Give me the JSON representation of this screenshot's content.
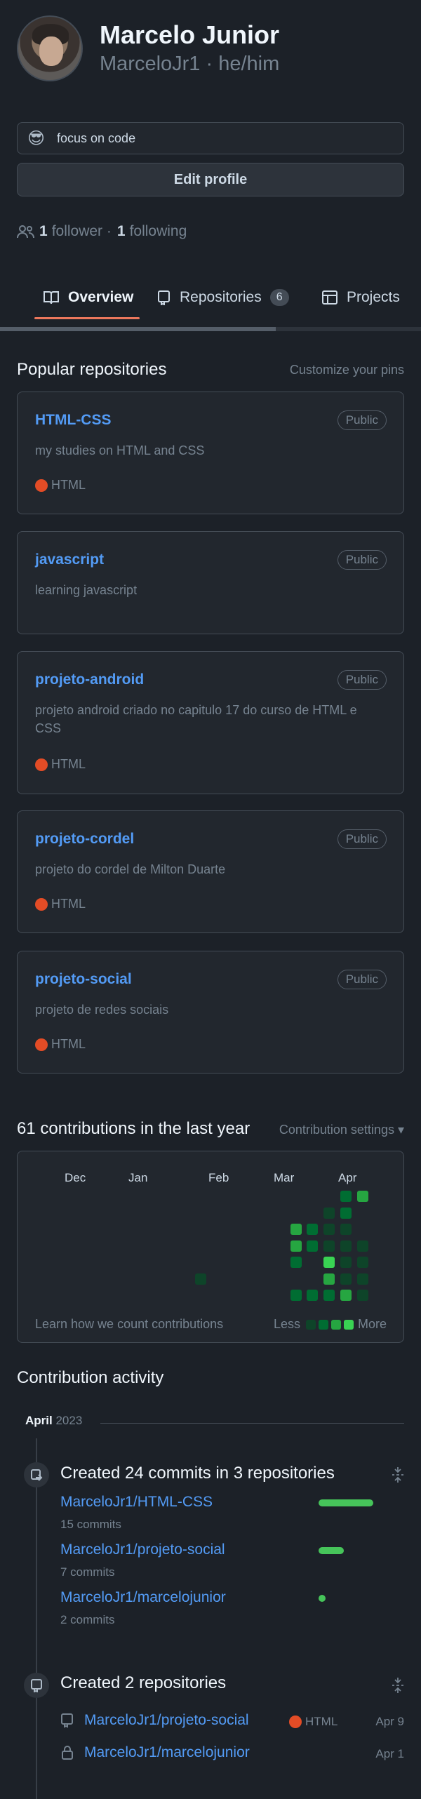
{
  "profile": {
    "fullname": "Marcelo Junior",
    "login": "MarceloJr1 · he/him",
    "status_emoji": "😎",
    "status_text": "focus on code",
    "edit_label": "Edit profile",
    "followers_count": "1",
    "followers_label": "follower ·",
    "following_count": "1",
    "following_label": "following"
  },
  "tabs": [
    {
      "label": "Overview",
      "icon": "book-icon"
    },
    {
      "label": "Repositories",
      "icon": "repo-icon",
      "count": "6"
    },
    {
      "label": "Projects",
      "icon": "table-icon"
    }
  ],
  "popular": {
    "title": "Popular repositories",
    "customize": "Customize your pins",
    "repos": [
      {
        "name": "HTML-CSS",
        "badge": "Public",
        "desc": "my studies on HTML and CSS",
        "lang": "HTML"
      },
      {
        "name": "javascript",
        "badge": "Public",
        "desc": "learning javascript",
        "lang": ""
      },
      {
        "name": "projeto-android",
        "badge": "Public",
        "desc": "projeto android criado no capitulo 17 do curso de HTML e CSS",
        "lang": "HTML"
      },
      {
        "name": "projeto-cordel",
        "badge": "Public",
        "desc": "projeto do cordel de Milton Duarte",
        "lang": "HTML"
      },
      {
        "name": "projeto-social",
        "badge": "Public",
        "desc": "projeto de redes sociais",
        "lang": "HTML"
      }
    ]
  },
  "contributions": {
    "title": "61 contributions in the last year",
    "settings": "Contribution settings ▾",
    "months": [
      "Dec",
      "Jan",
      "Feb",
      "Mar",
      "Apr"
    ],
    "learn": "Learn how we count contributions",
    "less": "Less",
    "more": "More",
    "colors": {
      "l0": "#2d333b",
      "l1": "#0e4429",
      "l2": "#006d32",
      "l3": "#26a641",
      "l4": "#39d353"
    }
  },
  "activity": {
    "title": "Contribution activity",
    "month": "April",
    "year": "2023",
    "commits_head": "Created 24 commits in 3 repositories",
    "commit_repos": [
      {
        "name": "MarceloJr1/HTML-CSS",
        "commits": "15 commits",
        "share": 15
      },
      {
        "name": "MarceloJr1/projeto-social",
        "commits": "7 commits",
        "share": 7
      },
      {
        "name": "MarceloJr1/marcelojunior",
        "commits": "2 commits",
        "share": 2
      }
    ],
    "repos_head": "Created 2 repositories",
    "new_repos": [
      {
        "name": "MarceloJr1/projeto-social",
        "lang": "HTML",
        "date": "Apr 9",
        "icon": "repo-icon"
      },
      {
        "name": "MarceloJr1/marcelojunior",
        "lang": "",
        "date": "Apr 1",
        "icon": "lock-icon"
      }
    ]
  }
}
